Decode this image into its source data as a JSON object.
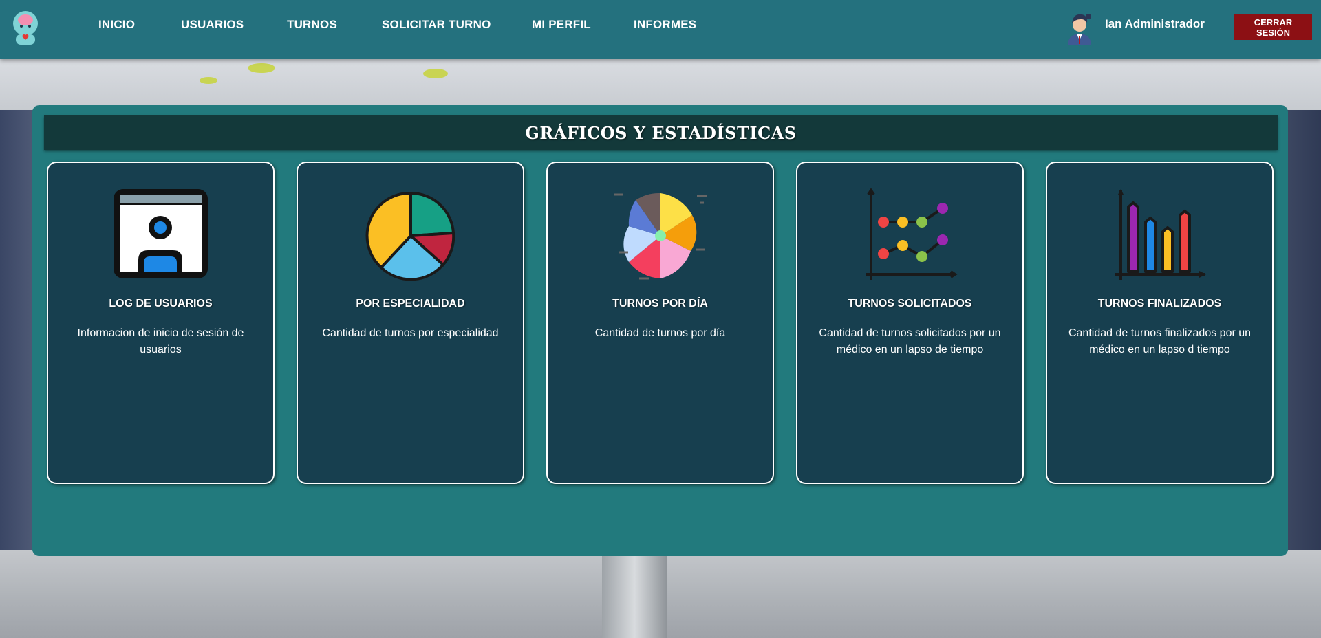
{
  "nav": {
    "links": [
      "INICIO",
      "USUARIOS",
      "TURNOS",
      "SOLICITAR TURNO",
      "MI PERFIL",
      "INFORMES"
    ],
    "user_name": "Ian Administrador",
    "logout_label": "CERRAR SESIÓN"
  },
  "page": {
    "title": "GRÁFICOS Y ESTADÍSTICAS"
  },
  "cards": [
    {
      "title": "LOG DE USUARIOS",
      "description": "Informacion de inicio de sesión de usuarios",
      "icon": "user-log-icon"
    },
    {
      "title": "POR ESPECIALIDAD",
      "description": "Cantidad de turnos por especialidad",
      "icon": "pie-chart-icon"
    },
    {
      "title": "TURNOS POR DÍA",
      "description": "Cantidad de turnos por día",
      "icon": "radial-chart-icon"
    },
    {
      "title": "TURNOS SOLICITADOS",
      "description": "Cantidad de turnos solicitados por un médico en un lapso de tiempo",
      "icon": "scatter-chart-icon"
    },
    {
      "title": "TURNOS FINALIZADOS",
      "description": "Cantidad de turnos finalizados por un médico en un lapso d tiempo",
      "icon": "bar-chart-icon"
    }
  ],
  "colors": {
    "navbar": "#24717e",
    "panel": "#227a7d",
    "panel_header": "#13393a",
    "card": "#173f4f",
    "logout": "#8c1014"
  }
}
